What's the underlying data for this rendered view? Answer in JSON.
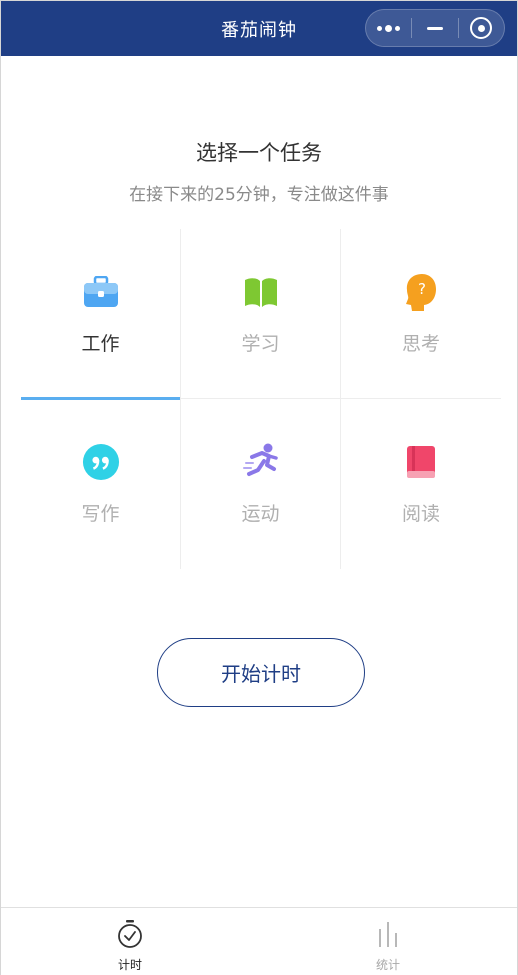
{
  "navbar": {
    "title": "番茄闹钟",
    "bg_color": "#1f3e85",
    "capsule": {
      "more_icon": "more-dots-icon",
      "minimize_icon": "minus-icon",
      "close_icon": "target-circle-icon"
    }
  },
  "main": {
    "heading": "选择一个任务",
    "subheading": "在接下来的25分钟，专注做这件事",
    "tasks": [
      {
        "label": "工作",
        "icon": "briefcase-icon",
        "color": "#4ea6f2",
        "selected": true
      },
      {
        "label": "学习",
        "icon": "book-icon",
        "color": "#7ec832",
        "selected": false
      },
      {
        "label": "思考",
        "icon": "head-question-icon",
        "color": "#f5a01f",
        "selected": false
      },
      {
        "label": "写作",
        "icon": "quote-icon",
        "color": "#2fd1e6",
        "selected": false
      },
      {
        "label": "运动",
        "icon": "runner-icon",
        "color": "#8a78e8",
        "selected": false
      },
      {
        "label": "阅读",
        "icon": "closed-book-icon",
        "color": "#f0466a",
        "selected": false
      }
    ],
    "start_button": "开始计时",
    "accent_color": "#5aaef0"
  },
  "tabbar": {
    "tabs": [
      {
        "label": "计时",
        "icon": "stopwatch-icon",
        "active": true
      },
      {
        "label": "统计",
        "icon": "bar-chart-icon",
        "active": false
      }
    ]
  }
}
